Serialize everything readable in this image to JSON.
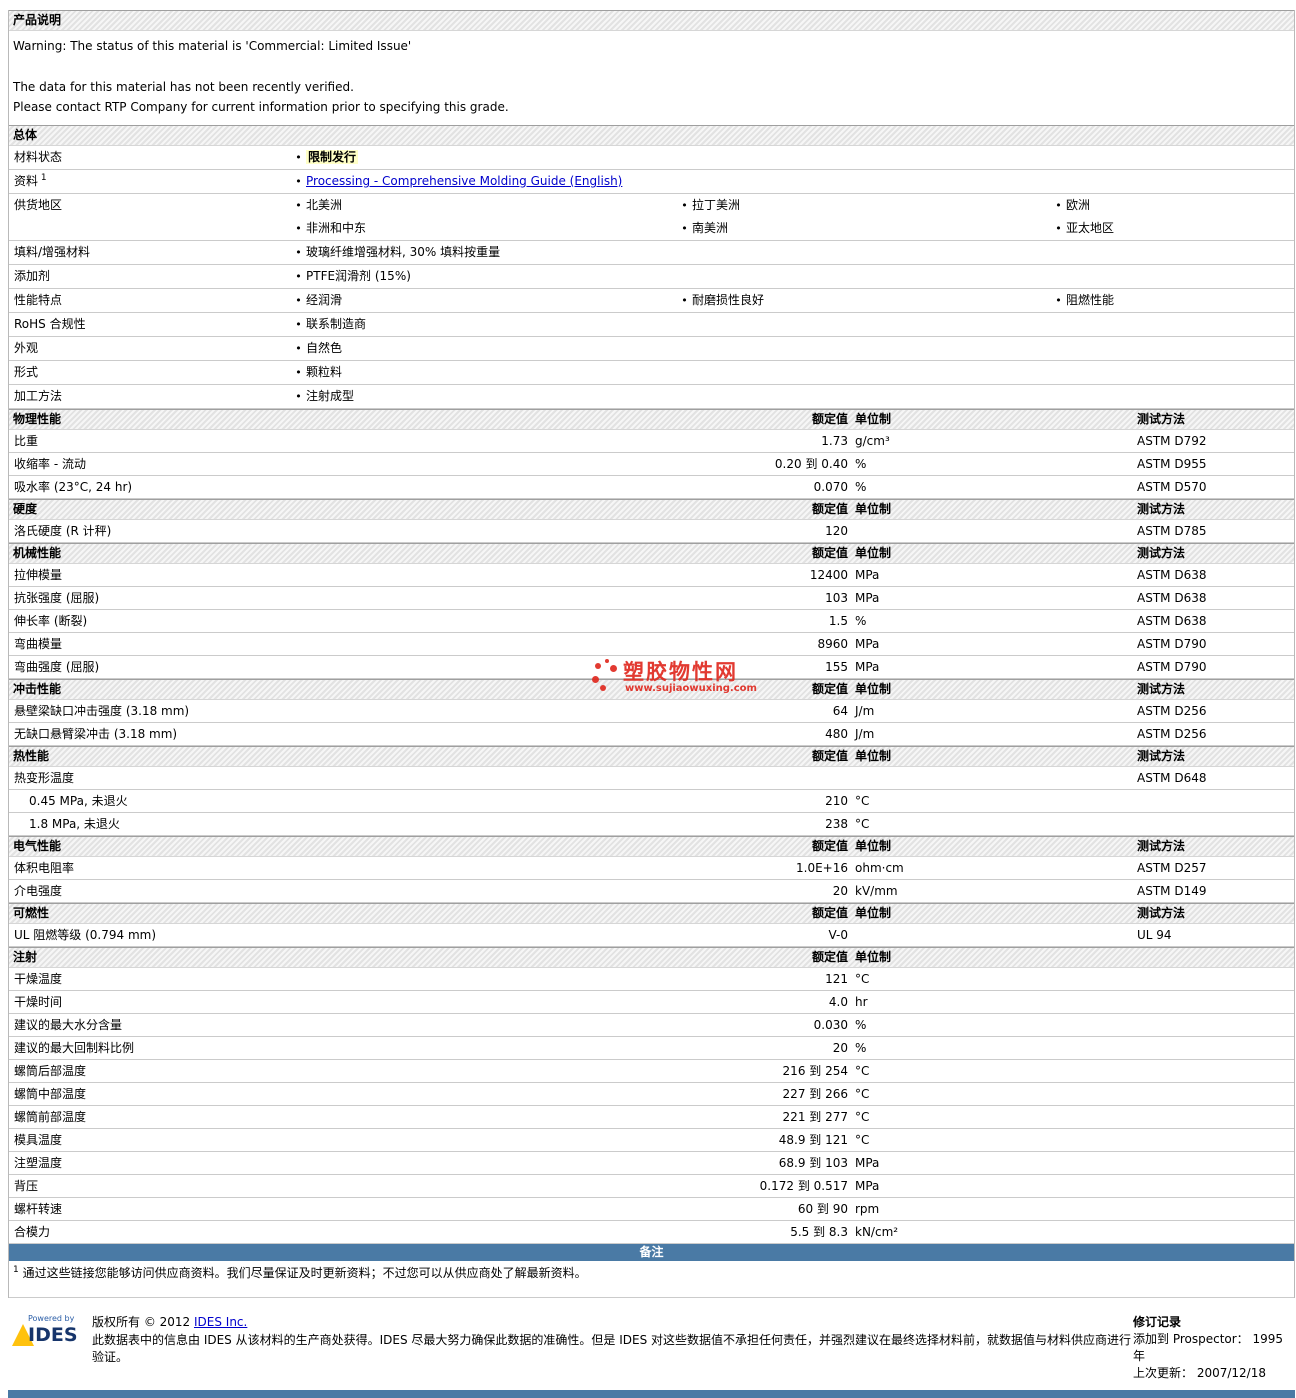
{
  "colors": {
    "accent_blue": "#4a7aa5",
    "highlight_yellow": "#ffffc6",
    "brand_red": "#e02a20",
    "link_blue": "#0000cc"
  },
  "header": {
    "title": "产品说明"
  },
  "warnings": [
    "Warning: The status of this material is 'Commercial: Limited Issue'",
    "The data for this material has not been recently verified.",
    "Please contact RTP Company for current information prior to specifying this grade."
  ],
  "general": {
    "title": "总体",
    "rows": [
      {
        "label": "材料状态",
        "cells": [
          [
            {
              "text": "限制发行",
              "style": "highlight"
            }
          ],
          [],
          []
        ]
      },
      {
        "label": "资料",
        "sup": "1",
        "cells": [
          [
            {
              "text": "Processing - Comprehensive Molding Guide (English)",
              "style": "link"
            }
          ],
          [],
          []
        ]
      },
      {
        "label": "供货地区",
        "cells": [
          [
            "北美洲",
            "非洲和中东"
          ],
          [
            "拉丁美洲",
            "南美洲"
          ],
          [
            "欧洲",
            "亚太地区"
          ]
        ]
      },
      {
        "label": "填料/增强材料",
        "cells": [
          [
            "玻璃纤维增强材料, 30% 填料按重量"
          ],
          [],
          []
        ]
      },
      {
        "label": "添加剂",
        "cells": [
          [
            "PTFE润滑剂 (15%)"
          ],
          [],
          []
        ]
      },
      {
        "label": "性能特点",
        "cells": [
          [
            "经润滑"
          ],
          [
            "耐磨损性良好"
          ],
          [
            "阻燃性能"
          ]
        ]
      },
      {
        "label": "RoHS 合规性",
        "cells": [
          [
            "联系制造商"
          ],
          [],
          []
        ]
      },
      {
        "label": "外观",
        "cells": [
          [
            "自然色"
          ],
          [],
          []
        ]
      },
      {
        "label": "形式",
        "cells": [
          [
            "颗粒料"
          ],
          [],
          []
        ]
      },
      {
        "label": "加工方法",
        "cells": [
          [
            "注射成型"
          ],
          [],
          []
        ]
      }
    ]
  },
  "columns": {
    "value": "额定值",
    "unit": "单位制",
    "method": "测试方法"
  },
  "sections": [
    {
      "title": "物理性能",
      "show_method": true,
      "rows": [
        {
          "label": "比重",
          "value": "1.73",
          "unit": "g/cm³",
          "method": "ASTM D792"
        },
        {
          "label": "收缩率 - 流动",
          "value": "0.20 到 0.40",
          "unit": "%",
          "method": "ASTM D955"
        },
        {
          "label": "吸水率 (23°C, 24 hr)",
          "value": "0.070",
          "unit": "%",
          "method": "ASTM D570"
        }
      ]
    },
    {
      "title": "硬度",
      "show_method": true,
      "rows": [
        {
          "label": "洛氏硬度 (R 计秤)",
          "value": "120",
          "unit": "",
          "method": "ASTM D785"
        }
      ]
    },
    {
      "title": "机械性能",
      "show_method": true,
      "rows": [
        {
          "label": "拉伸模量",
          "value": "12400",
          "unit": "MPa",
          "method": "ASTM D638"
        },
        {
          "label": "抗张强度 (屈服)",
          "value": "103",
          "unit": "MPa",
          "method": "ASTM D638"
        },
        {
          "label": "伸长率 (断裂)",
          "value": "1.5",
          "unit": "%",
          "method": "ASTM D638"
        },
        {
          "label": "弯曲模量",
          "value": "8960",
          "unit": "MPa",
          "method": "ASTM D790"
        },
        {
          "label": "弯曲强度 (屈服)",
          "value": "155",
          "unit": "MPa",
          "method": "ASTM D790"
        }
      ]
    },
    {
      "title": "冲击性能",
      "show_method": true,
      "rows": [
        {
          "label": "悬壁梁缺口冲击强度 (3.18 mm)",
          "value": "64",
          "unit": "J/m",
          "method": "ASTM D256"
        },
        {
          "label": "无缺口悬臂梁冲击 (3.18 mm)",
          "value": "480",
          "unit": "J/m",
          "method": "ASTM D256"
        }
      ]
    },
    {
      "title": "热性能",
      "show_method": true,
      "rows": [
        {
          "label": "热变形温度",
          "value": "",
          "unit": "",
          "method": "ASTM D648"
        },
        {
          "label": "0.45 MPa, 未退火",
          "indent": true,
          "value": "210",
          "unit": "°C",
          "method": ""
        },
        {
          "label": "1.8 MPa, 未退火",
          "indent": true,
          "value": "238",
          "unit": "°C",
          "method": ""
        }
      ]
    },
    {
      "title": "电气性能",
      "show_method": true,
      "rows": [
        {
          "label": "体积电阻率",
          "value": "1.0E+16",
          "unit": "ohm·cm",
          "method": "ASTM D257"
        },
        {
          "label": "介电强度",
          "value": "20",
          "unit": "kV/mm",
          "method": "ASTM D149"
        }
      ]
    },
    {
      "title": "可燃性",
      "show_method": true,
      "rows": [
        {
          "label": "UL 阻燃等级 (0.794 mm)",
          "value": "V-0",
          "unit": "",
          "method": "UL 94"
        }
      ]
    },
    {
      "title": "注射",
      "show_method": false,
      "rows": [
        {
          "label": "干燥温度",
          "value": "121",
          "unit": "°C",
          "method": ""
        },
        {
          "label": "干燥时间",
          "value": "4.0",
          "unit": "hr",
          "method": ""
        },
        {
          "label": "建议的最大水分含量",
          "value": "0.030",
          "unit": "%",
          "method": ""
        },
        {
          "label": "建议的最大回制料比例",
          "value": "20",
          "unit": "%",
          "method": ""
        },
        {
          "label": "螺筒后部温度",
          "value": "216 到 254",
          "unit": "°C",
          "method": ""
        },
        {
          "label": "螺筒中部温度",
          "value": "227 到 266",
          "unit": "°C",
          "method": ""
        },
        {
          "label": "螺筒前部温度",
          "value": "221 到 277",
          "unit": "°C",
          "method": ""
        },
        {
          "label": "模具温度",
          "value": "48.9 到 121",
          "unit": "°C",
          "method": ""
        },
        {
          "label": "注塑温度",
          "value": "68.9 到 103",
          "unit": "MPa",
          "method": ""
        },
        {
          "label": "背压",
          "value": "0.172 到 0.517",
          "unit": "MPa",
          "method": ""
        },
        {
          "label": "螺杆转速",
          "value": "60 到 90",
          "unit": "rpm",
          "method": ""
        },
        {
          "label": "合模力",
          "value": "5.5 到 8.3",
          "unit": "kN/cm²",
          "method": ""
        }
      ]
    }
  ],
  "notes": {
    "bar_label": "备注",
    "footnote_sup": "1",
    "footnote_text": "通过这些链接您能够访问供应商资料。我们尽量保证及时更新资料；不过您可以从供应商处了解最新资料。"
  },
  "watermark": {
    "site_name": "塑胶物性网",
    "site_url": "www.sujiaowuxing.com"
  },
  "footer": {
    "powered_by": "Powered by",
    "logo_text": "IDES",
    "copyright_prefix": "版权所有  © 2012 ",
    "copyright_link": "IDES Inc.",
    "disclaimer": "此数据表中的信息由 IDES 从该材料的生产商处获得。IDES 尽最大努力确保此数据的准确性。但是 IDES 对这些数据值不承担任何责任，并强烈建议在最终选择材料前，就数据值与材料供应商进行验证。",
    "revision_title": "修订记录",
    "revision_line1": "添加到 Prospector：  1995年",
    "revision_line2": "上次更新：  2007/12/18"
  }
}
